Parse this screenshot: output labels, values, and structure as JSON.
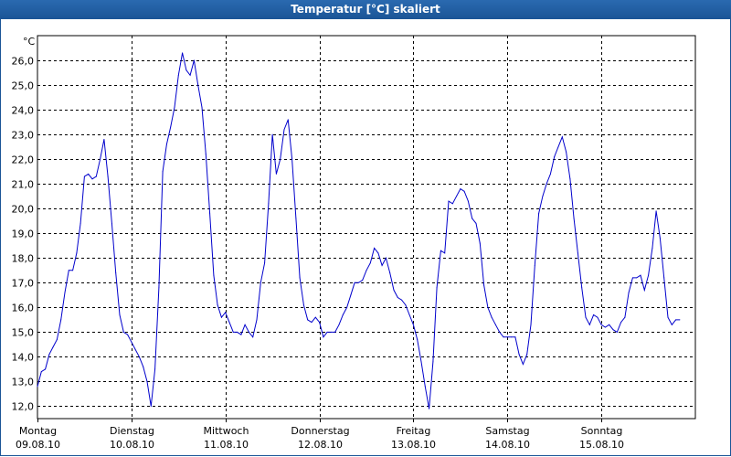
{
  "window": {
    "title": "Temperatur [°C] skaliert"
  },
  "chart_data": {
    "type": "line",
    "title": "Temperatur [°C] skaliert",
    "ylabel": "°C",
    "xlabel": "",
    "ylim": [
      11.5,
      27.0
    ],
    "yticks": [
      12,
      13,
      14,
      15,
      16,
      17,
      18,
      19,
      20,
      21,
      22,
      23,
      24,
      25,
      26
    ],
    "ytick_labels": [
      "12,0",
      "13,0",
      "14,0",
      "15,0",
      "16,0",
      "17,0",
      "18,0",
      "19,0",
      "20,0",
      "21,0",
      "22,0",
      "23,0",
      "24,0",
      "25,0",
      "26,0"
    ],
    "xlim": [
      "09.08.10 00:00",
      "16.08.10 00:00"
    ],
    "x_ticks": [
      {
        "day": "Montag",
        "date": "09.08.10"
      },
      {
        "day": "Dienstag",
        "date": "10.08.10"
      },
      {
        "day": "Mittwoch",
        "date": "11.08.10"
      },
      {
        "day": "Donnerstag",
        "date": "12.08.10"
      },
      {
        "day": "Freitag",
        "date": "13.08.10"
      },
      {
        "day": "Samstag",
        "date": "14.08.10"
      },
      {
        "day": "Sonntag",
        "date": "15.08.10"
      }
    ],
    "grid": true,
    "line_color": "#0000cc",
    "series": [
      {
        "name": "",
        "values": [
          [
            "09.08.10 00:00",
            12.8
          ],
          [
            "09.08.10 01:00",
            13.4
          ],
          [
            "09.08.10 02:00",
            13.5
          ],
          [
            "09.08.10 03:00",
            14.1
          ],
          [
            "09.08.10 04:00",
            14.4
          ],
          [
            "09.08.10 05:00",
            14.7
          ],
          [
            "09.08.10 06:00",
            15.5
          ],
          [
            "09.08.10 07:00",
            16.6
          ],
          [
            "09.08.10 08:00",
            17.5
          ],
          [
            "09.08.10 09:00",
            17.5
          ],
          [
            "09.08.10 10:00",
            18.2
          ],
          [
            "09.08.10 11:00",
            19.4
          ],
          [
            "09.08.10 12:00",
            21.3
          ],
          [
            "09.08.10 13:00",
            21.4
          ],
          [
            "09.08.10 14:00",
            21.2
          ],
          [
            "09.08.10 15:00",
            21.3
          ],
          [
            "09.08.10 16:00",
            22.0
          ],
          [
            "09.08.10 17:00",
            22.8
          ],
          [
            "09.08.10 18:00",
            21.3
          ],
          [
            "09.08.10 19:00",
            19.4
          ],
          [
            "09.08.10 20:00",
            17.4
          ],
          [
            "09.08.10 21:00",
            15.7
          ],
          [
            "09.08.10 22:00",
            15.0
          ],
          [
            "09.08.10 23:00",
            14.9
          ],
          [
            "10.08.10 00:00",
            14.6
          ],
          [
            "10.08.10 01:00",
            14.3
          ],
          [
            "10.08.10 02:00",
            14.0
          ],
          [
            "10.08.10 03:00",
            13.6
          ],
          [
            "10.08.10 04:00",
            13.0
          ],
          [
            "10.08.10 05:00",
            12.0
          ],
          [
            "10.08.10 06:00",
            13.5
          ],
          [
            "10.08.10 07:00",
            16.8
          ],
          [
            "10.08.10 08:00",
            21.5
          ],
          [
            "10.08.10 09:00",
            22.6
          ],
          [
            "10.08.10 10:00",
            23.3
          ],
          [
            "10.08.10 11:00",
            24.1
          ],
          [
            "10.08.10 12:00",
            25.4
          ],
          [
            "10.08.10 13:00",
            26.3
          ],
          [
            "10.08.10 14:00",
            25.6
          ],
          [
            "10.08.10 15:00",
            25.4
          ],
          [
            "10.08.10 16:00",
            26.0
          ],
          [
            "10.08.10 17:00",
            25.0
          ],
          [
            "10.08.10 18:00",
            24.1
          ],
          [
            "10.08.10 19:00",
            22.2
          ],
          [
            "10.08.10 20:00",
            19.8
          ],
          [
            "10.08.10 21:00",
            17.3
          ],
          [
            "10.08.10 22:00",
            16.1
          ],
          [
            "10.08.10 23:00",
            15.6
          ],
          [
            "11.08.10 00:00",
            15.8
          ],
          [
            "11.08.10 01:00",
            15.4
          ],
          [
            "11.08.10 02:00",
            15.0
          ],
          [
            "11.08.10 03:00",
            15.0
          ],
          [
            "11.08.10 04:00",
            14.9
          ],
          [
            "11.08.10 05:00",
            15.3
          ],
          [
            "11.08.10 06:00",
            15.0
          ],
          [
            "11.08.10 07:00",
            14.8
          ],
          [
            "11.08.10 08:00",
            15.5
          ],
          [
            "11.08.10 09:00",
            17.0
          ],
          [
            "11.08.10 10:00",
            17.8
          ],
          [
            "11.08.10 11:00",
            20.2
          ],
          [
            "11.08.10 12:00",
            23.0
          ],
          [
            "11.08.10 13:00",
            21.4
          ],
          [
            "11.08.10 14:00",
            22.0
          ],
          [
            "11.08.10 15:00",
            23.2
          ],
          [
            "11.08.10 16:00",
            23.6
          ],
          [
            "11.08.10 17:00",
            22.0
          ],
          [
            "11.08.10 18:00",
            19.6
          ],
          [
            "11.08.10 19:00",
            17.2
          ],
          [
            "11.08.10 20:00",
            16.1
          ],
          [
            "11.08.10 21:00",
            15.5
          ],
          [
            "11.08.10 22:00",
            15.4
          ],
          [
            "11.08.10 23:00",
            15.6
          ],
          [
            "12.08.10 00:00",
            15.4
          ],
          [
            "12.08.10 01:00",
            14.8
          ],
          [
            "12.08.10 02:00",
            15.0
          ],
          [
            "12.08.10 03:00",
            15.0
          ],
          [
            "12.08.10 04:00",
            15.0
          ],
          [
            "12.08.10 05:00",
            15.3
          ],
          [
            "12.08.10 06:00",
            15.7
          ],
          [
            "12.08.10 07:00",
            16.0
          ],
          [
            "12.08.10 08:00",
            16.5
          ],
          [
            "12.08.10 09:00",
            17.0
          ],
          [
            "12.08.10 10:00",
            17.0
          ],
          [
            "12.08.10 11:00",
            17.1
          ],
          [
            "12.08.10 12:00",
            17.5
          ],
          [
            "12.08.10 13:00",
            17.8
          ],
          [
            "12.08.10 14:00",
            18.4
          ],
          [
            "12.08.10 15:00",
            18.2
          ],
          [
            "12.08.10 16:00",
            17.7
          ],
          [
            "12.08.10 17:00",
            18.0
          ],
          [
            "12.08.10 18:00",
            17.4
          ],
          [
            "12.08.10 19:00",
            16.7
          ],
          [
            "12.08.10 20:00",
            16.4
          ],
          [
            "12.08.10 21:00",
            16.3
          ],
          [
            "12.08.10 22:00",
            16.1
          ],
          [
            "12.08.10 23:00",
            15.7
          ],
          [
            "13.08.10 00:00",
            15.3
          ],
          [
            "13.08.10 01:00",
            14.7
          ],
          [
            "13.08.10 02:00",
            13.8
          ],
          [
            "13.08.10 03:00",
            12.8
          ],
          [
            "13.08.10 04:00",
            11.9
          ],
          [
            "13.08.10 05:00",
            13.8
          ],
          [
            "13.08.10 06:00",
            16.8
          ],
          [
            "13.08.10 07:00",
            18.3
          ],
          [
            "13.08.10 08:00",
            18.2
          ],
          [
            "13.08.10 09:00",
            20.3
          ],
          [
            "13.08.10 10:00",
            20.2
          ],
          [
            "13.08.10 11:00",
            20.5
          ],
          [
            "13.08.10 12:00",
            20.8
          ],
          [
            "13.08.10 13:00",
            20.7
          ],
          [
            "13.08.10 14:00",
            20.3
          ],
          [
            "13.08.10 15:00",
            19.6
          ],
          [
            "13.08.10 16:00",
            19.4
          ],
          [
            "13.08.10 17:00",
            18.6
          ],
          [
            "13.08.10 18:00",
            16.9
          ],
          [
            "13.08.10 19:00",
            16.0
          ],
          [
            "13.08.10 20:00",
            15.6
          ],
          [
            "13.08.10 21:00",
            15.3
          ],
          [
            "13.08.10 22:00",
            15.0
          ],
          [
            "13.08.10 23:00",
            14.8
          ],
          [
            "14.08.10 00:00",
            14.8
          ],
          [
            "14.08.10 01:00",
            14.8
          ],
          [
            "14.08.10 02:00",
            14.8
          ],
          [
            "14.08.10 03:00",
            14.1
          ],
          [
            "14.08.10 04:00",
            13.7
          ],
          [
            "14.08.10 05:00",
            14.1
          ],
          [
            "14.08.10 06:00",
            15.3
          ],
          [
            "14.08.10 07:00",
            17.7
          ],
          [
            "14.08.10 08:00",
            19.8
          ],
          [
            "14.08.10 09:00",
            20.5
          ],
          [
            "14.08.10 10:00",
            21.0
          ],
          [
            "14.08.10 11:00",
            21.4
          ],
          [
            "14.08.10 12:00",
            22.1
          ],
          [
            "14.08.10 13:00",
            22.5
          ],
          [
            "14.08.10 14:00",
            22.9
          ],
          [
            "14.08.10 15:00",
            22.3
          ],
          [
            "14.08.10 16:00",
            21.2
          ],
          [
            "14.08.10 17:00",
            19.6
          ],
          [
            "14.08.10 18:00",
            18.2
          ],
          [
            "14.08.10 19:00",
            16.8
          ],
          [
            "14.08.10 20:00",
            15.6
          ],
          [
            "14.08.10 21:00",
            15.3
          ],
          [
            "14.08.10 22:00",
            15.7
          ],
          [
            "14.08.10 23:00",
            15.6
          ],
          [
            "15.08.10 00:00",
            15.3
          ],
          [
            "15.08.10 01:00",
            15.2
          ],
          [
            "15.08.10 02:00",
            15.3
          ],
          [
            "15.08.10 03:00",
            15.1
          ],
          [
            "15.08.10 04:00",
            15.0
          ],
          [
            "15.08.10 05:00",
            15.4
          ],
          [
            "15.08.10 06:00",
            15.6
          ],
          [
            "15.08.10 07:00",
            16.6
          ],
          [
            "15.08.10 08:00",
            17.2
          ],
          [
            "15.08.10 09:00",
            17.2
          ],
          [
            "15.08.10 10:00",
            17.3
          ],
          [
            "15.08.10 11:00",
            16.7
          ],
          [
            "15.08.10 12:00",
            17.3
          ],
          [
            "15.08.10 13:00",
            18.4
          ],
          [
            "15.08.10 14:00",
            19.9
          ],
          [
            "15.08.10 15:00",
            18.8
          ],
          [
            "15.08.10 16:00",
            17.2
          ],
          [
            "15.08.10 17:00",
            15.6
          ],
          [
            "15.08.10 18:00",
            15.3
          ],
          [
            "15.08.10 19:00",
            15.5
          ],
          [
            "15.08.10 20:00",
            15.5
          ]
        ]
      }
    ]
  }
}
